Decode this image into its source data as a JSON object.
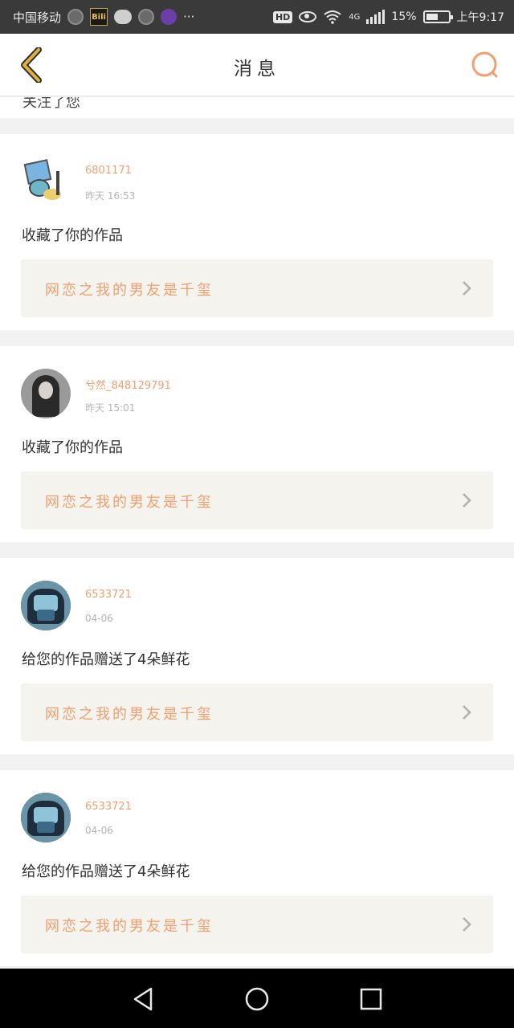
{
  "status_bar": {
    "carrier": "中国移动",
    "bili_icon_text": "Bili",
    "more": "···",
    "hd_badge": "HD",
    "network": "4G",
    "speed": "15%",
    "time": "上午9:17"
  },
  "header": {
    "title": "消息",
    "back_icon": "chevron-left-icon",
    "search_icon": "search-icon",
    "accent_color": "#f0a070",
    "back_color": "#e0b040"
  },
  "previous_item_fragment": "关注了您",
  "notifications": [
    {
      "username": "6801171",
      "time": "昨天 16:53",
      "message": "收藏了你的作品",
      "work_title": "网恋之我的男友是千玺",
      "avatar": "sketch"
    },
    {
      "username": "兮然_848129791",
      "time": "昨天 15:01",
      "message": "收藏了你的作品",
      "work_title": "网恋之我的男友是千玺",
      "avatar": "girl"
    },
    {
      "username": "6533721",
      "time": "04-06",
      "message": "给您的作品赠送了4朵鲜花",
      "work_title": "网恋之我的男友是千玺",
      "avatar": "armor"
    },
    {
      "username": "6533721",
      "time": "04-06",
      "message": "给您的作品赠送了4朵鲜花",
      "work_title": "网恋之我的男友是千玺",
      "avatar": "armor"
    }
  ],
  "nav_bar": {
    "back_icon": "triangle-back-icon",
    "home_icon": "circle-home-icon",
    "recents_icon": "square-recents-icon"
  }
}
